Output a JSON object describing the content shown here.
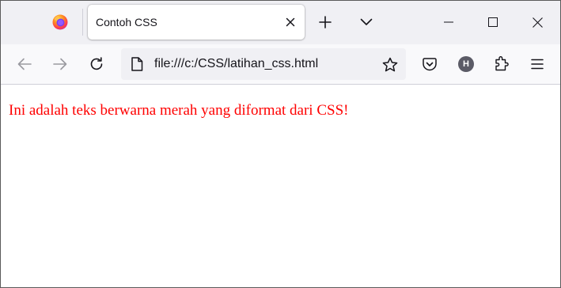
{
  "browser": {
    "tab": {
      "title": "Contoh CSS"
    },
    "address_bar": {
      "url": "file:///c:/CSS/latihan_css.html"
    },
    "account": {
      "initial": "H"
    },
    "icons": {
      "app_logo": "firefox-logo-icon",
      "tab_close": "close-icon",
      "new_tab": "plus-icon",
      "list_tabs": "chevron-down-icon",
      "minimize": "minimize-icon",
      "maximize": "maximize-icon",
      "close_window": "close-icon",
      "back": "arrow-left-icon",
      "forward": "arrow-right-icon",
      "reload": "reload-icon",
      "page": "page-icon",
      "bookmark": "star-icon",
      "pocket": "pocket-icon",
      "extensions": "puzzle-icon",
      "menu": "hamburger-menu-icon"
    }
  },
  "page": {
    "text": "Ini adalah teks berwarna merah yang diformat dari CSS!",
    "text_color": "#ff0000"
  }
}
